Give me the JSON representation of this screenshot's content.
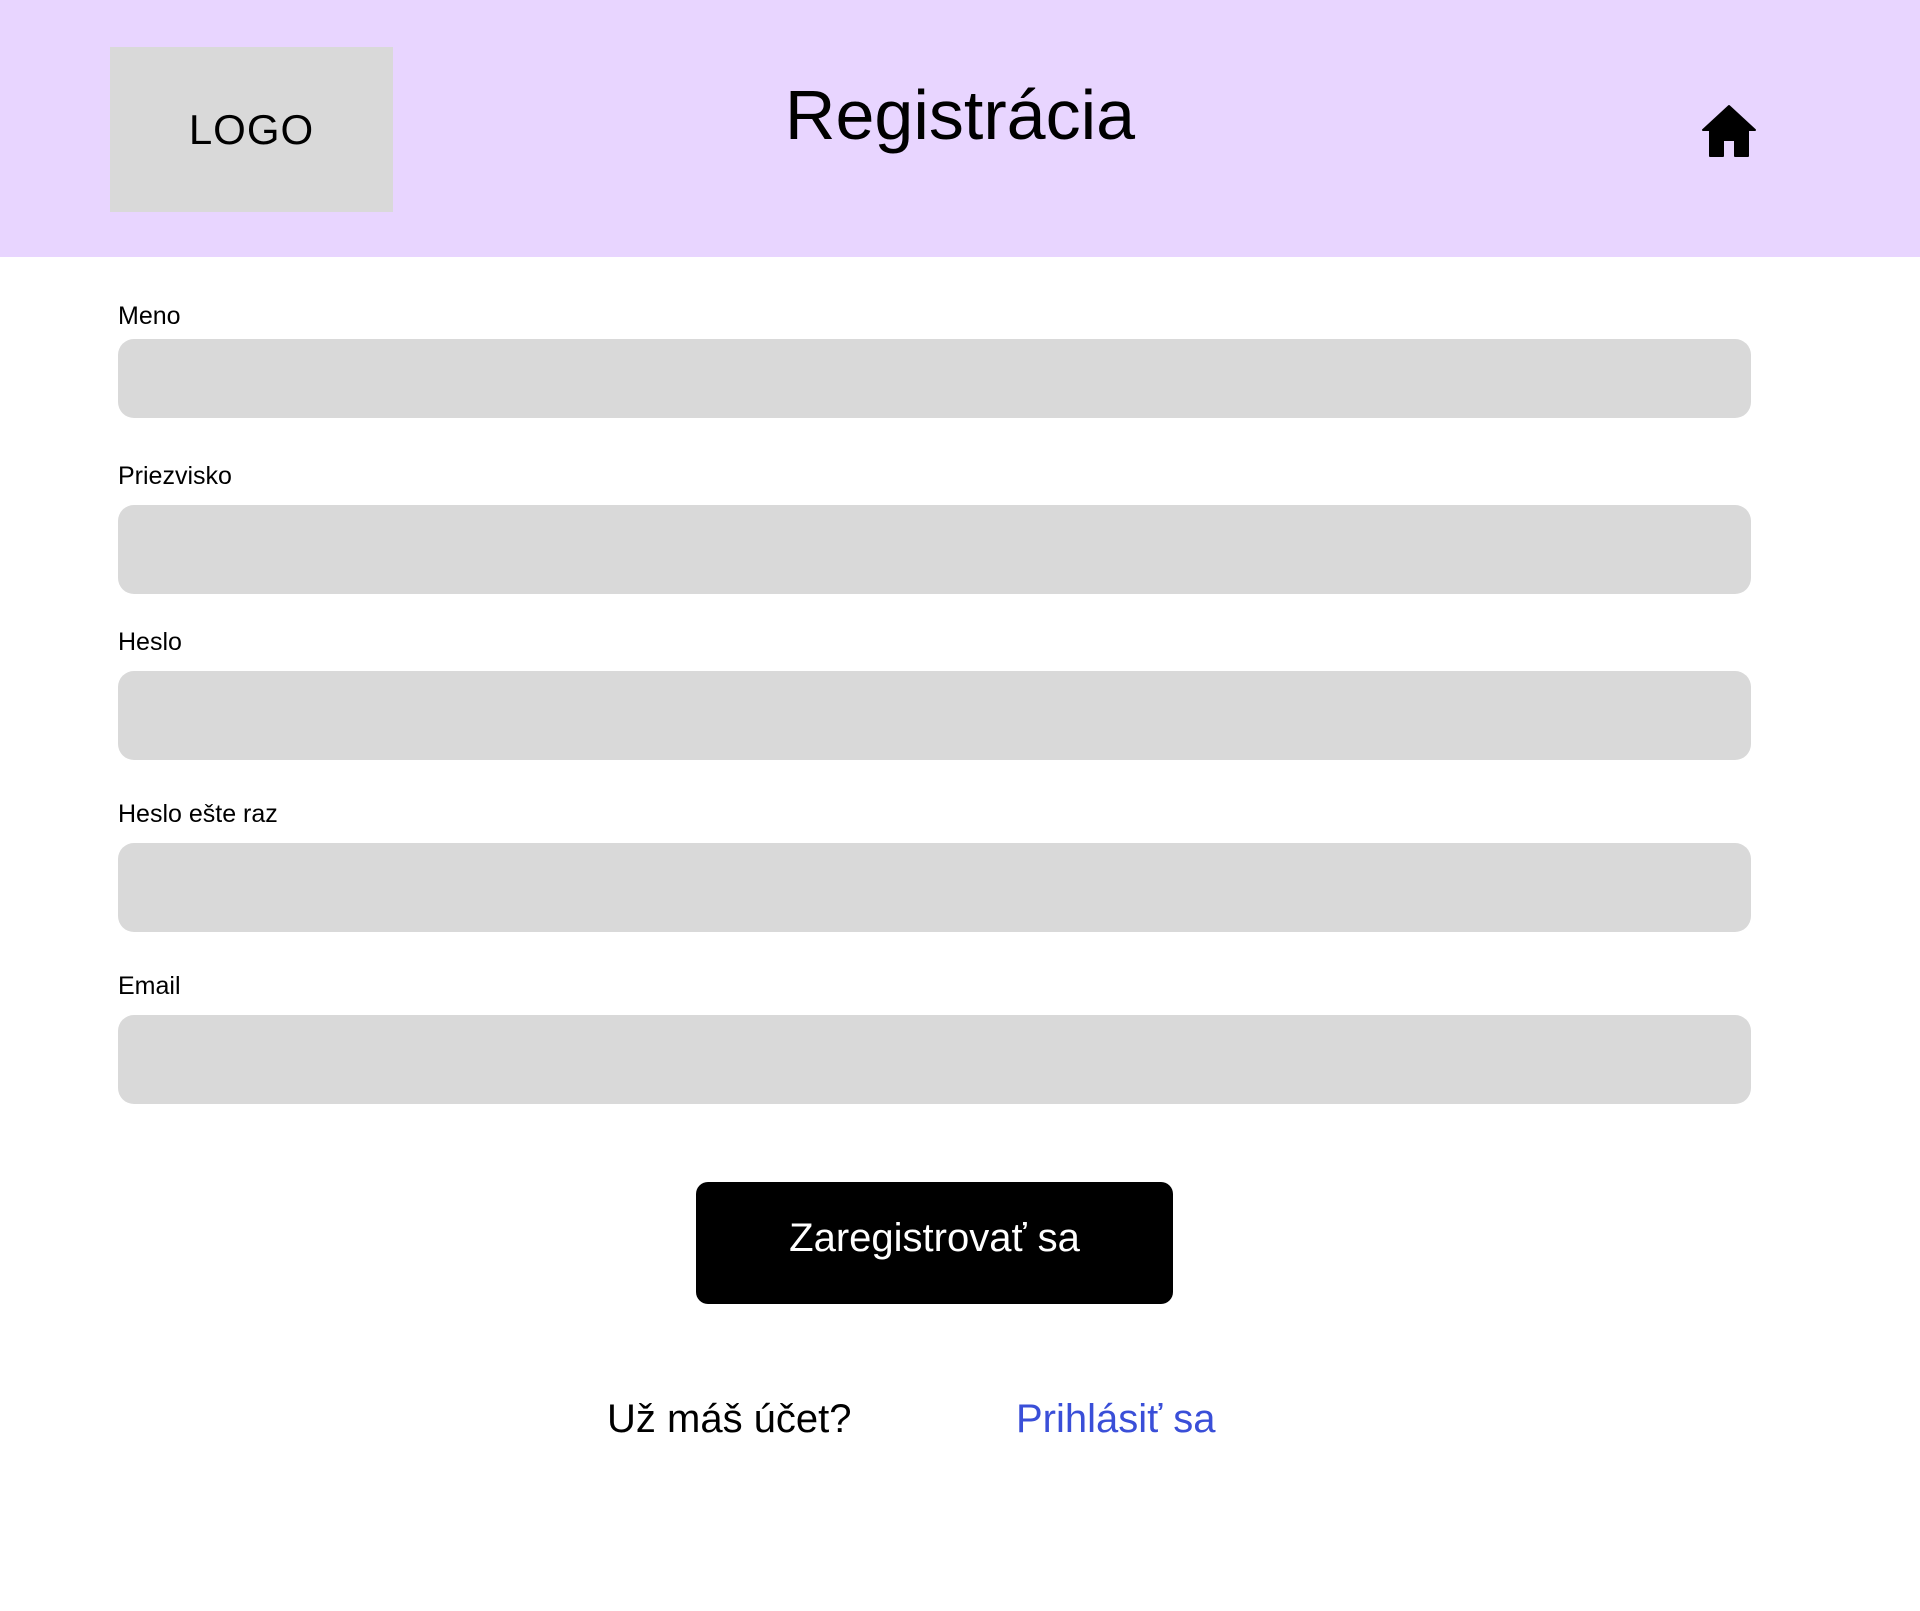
{
  "header": {
    "logo_text": "LOGO",
    "title": "Registrácia",
    "home_icon": "home-icon"
  },
  "form": {
    "fields": [
      {
        "label": "Meno",
        "value": "",
        "placeholder": ""
      },
      {
        "label": "Priezvisko",
        "value": "",
        "placeholder": ""
      },
      {
        "label": "Heslo",
        "value": "",
        "placeholder": ""
      },
      {
        "label": "Heslo ešte raz",
        "value": "",
        "placeholder": ""
      },
      {
        "label": "Email",
        "value": "",
        "placeholder": ""
      }
    ],
    "submit_label": "Zaregistrovať sa"
  },
  "footer": {
    "question": "Už máš účet?",
    "login_link": "Prihlásiť sa"
  },
  "colors": {
    "header_bg": "#e8d5ff",
    "input_bg": "#d9d9d9",
    "button_bg": "#000000",
    "link": "#3a4fd8"
  }
}
